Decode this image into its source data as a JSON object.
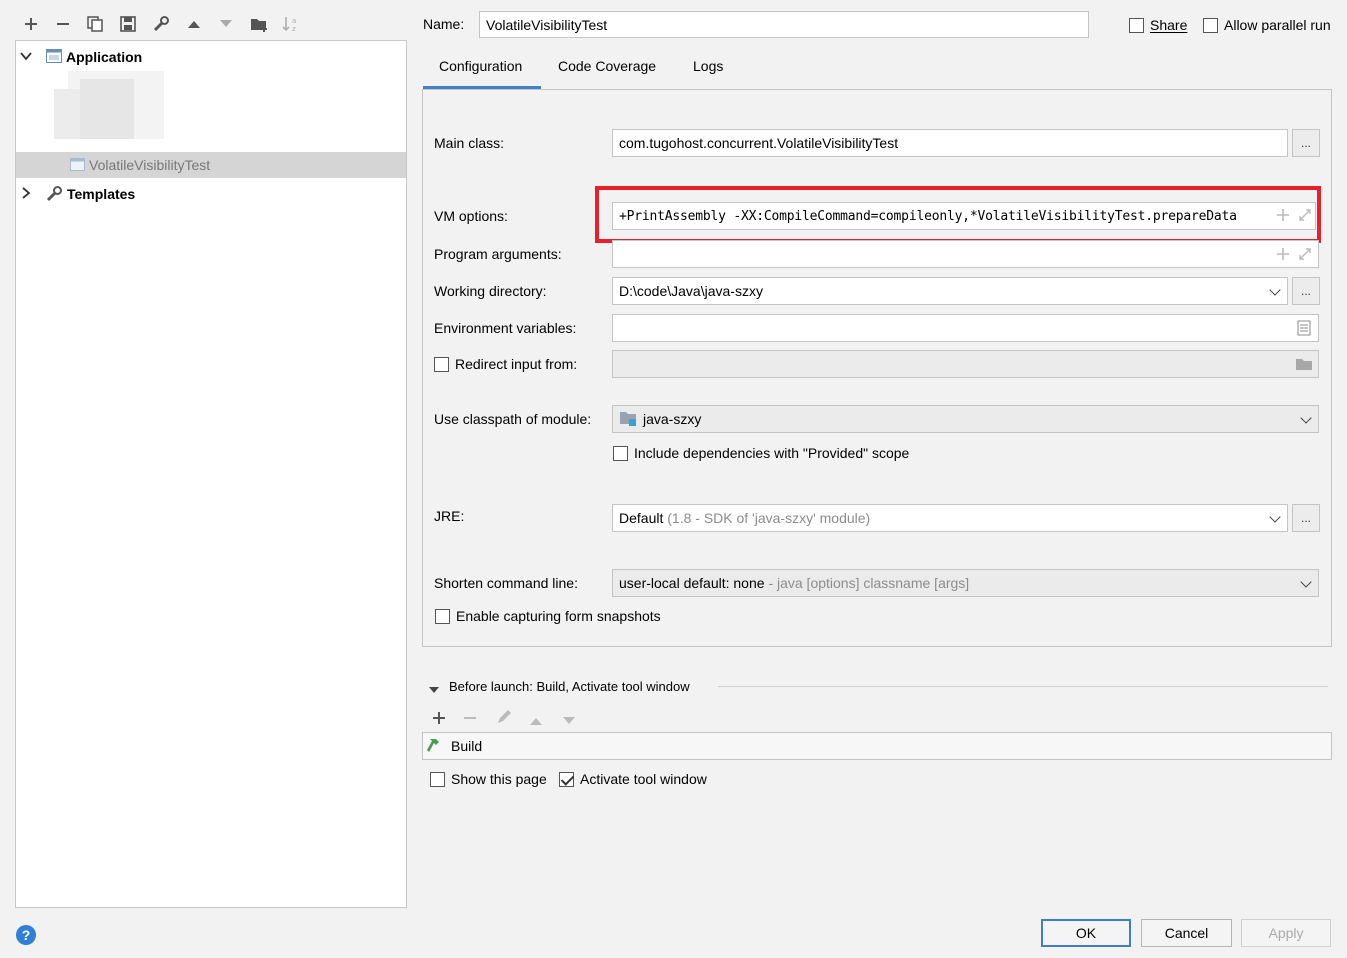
{
  "toolbar": {
    "add_icon": "plus-icon",
    "remove_icon": "minus-icon",
    "copy_icon": "copy-icon",
    "save_icon": "save-icon",
    "edit_icon": "wrench-icon",
    "move_up_icon": "arrow-up-icon",
    "move_down_icon": "arrow-down-icon",
    "folder_icon": "new-folder-icon",
    "sort_icon": "sort-az-icon"
  },
  "tree": {
    "application_label": "Application",
    "item_label": "VolatileVisibilityTest",
    "templates_label": "Templates"
  },
  "header": {
    "name_label": "Name:",
    "name_value": "VolatileVisibilityTest",
    "share_label": "Share",
    "allow_parallel_label": "Allow parallel run"
  },
  "tabs": [
    {
      "label": "Configuration",
      "active": true
    },
    {
      "label": "Code Coverage",
      "active": false
    },
    {
      "label": "Logs",
      "active": false
    }
  ],
  "form": {
    "main_class_label": "Main class:",
    "main_class_value": "com.tugohost.concurrent.VolatileVisibilityTest",
    "vm_options_label": "VM options:",
    "vm_options_value": "+PrintAssembly -XX:CompileCommand=compileonly,*VolatileVisibilityTest.prepareData",
    "program_args_label": "Program arguments:",
    "program_args_value": "",
    "working_dir_label": "Working directory:",
    "working_dir_value": "D:\\code\\Java\\java-szxy",
    "env_vars_label": "Environment variables:",
    "env_vars_value": "",
    "redirect_label": "Redirect input from:",
    "classpath_label": "Use classpath of module:",
    "classpath_value": "java-szxy",
    "include_deps_label": "Include dependencies with \"Provided\" scope",
    "jre_label": "JRE:",
    "jre_value": "Default",
    "jre_hint": "(1.8 - SDK of 'java-szxy' module)",
    "shorten_label": "Shorten command line:",
    "shorten_value": "user-local default: none",
    "shorten_hint": "- java [options] classname [args]",
    "snapshots_label": "Enable capturing form snapshots",
    "dots_label": "..."
  },
  "before_launch": {
    "title": "Before launch: Build, Activate tool window",
    "task_label": "Build",
    "show_page_label": "Show this page",
    "activate_label": "Activate tool window"
  },
  "footer": {
    "help_label": "?",
    "ok_label": "OK",
    "cancel_label": "Cancel",
    "apply_label": "Apply"
  },
  "colors": {
    "highlight_red": "#e8202a",
    "tab_underline": "#4083c9",
    "ok_border": "#3d7ec9",
    "help_blue": "#2f7fd6"
  }
}
